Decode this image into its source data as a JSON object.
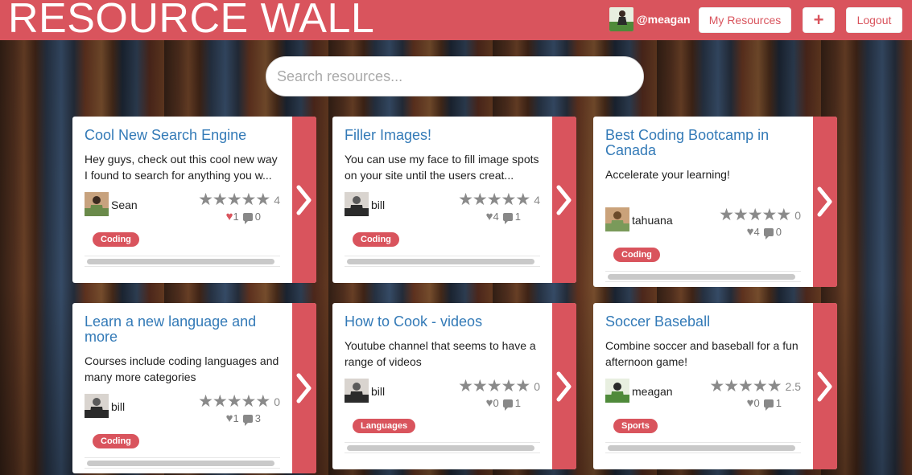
{
  "header": {
    "brand": "RESOURCE WALL",
    "username": "@meagan",
    "my_resources": "My Resources",
    "add_label": "+",
    "logout": "Logout"
  },
  "search": {
    "placeholder": "Search resources..."
  },
  "colors": {
    "accent": "#d9545d",
    "title": "#337ab7"
  },
  "cards": [
    {
      "title": "Cool New Search Engine",
      "description": "Hey guys, check out this cool new way I found to search for anything you w...",
      "author": "Sean",
      "rating": "4",
      "likes": "1",
      "comments": "0",
      "liked": true,
      "tag": "Coding",
      "stars": 0
    },
    {
      "title": "Filler Images!",
      "description": "You can use my face to fill image spots on your site until the users creat...",
      "author": "bill",
      "rating": "4",
      "likes": "4",
      "comments": "1",
      "liked": false,
      "tag": "Coding",
      "stars": 0
    },
    {
      "title": "Best Coding Bootcamp in Canada",
      "description": "Accelerate your learning!",
      "author": "tahuana",
      "rating": "0",
      "likes": "4",
      "comments": "0",
      "liked": false,
      "tag": "Coding",
      "stars": 0
    },
    {
      "title": "Learn a new language and more",
      "description": "Courses include coding languages and many more categories",
      "author": "bill",
      "rating": "0",
      "likes": "1",
      "comments": "3",
      "liked": false,
      "tag": "Coding",
      "stars": 0
    },
    {
      "title": "How to Cook - videos",
      "description": "Youtube channel that seems to have a range of videos",
      "author": "bill",
      "rating": "0",
      "likes": "0",
      "comments": "1",
      "liked": false,
      "tag": "Languages",
      "stars": 0
    },
    {
      "title": "Soccer Baseball",
      "description": "Combine soccer and baseball for a fun afternoon game!",
      "author": "meagan",
      "rating": "2.5",
      "likes": "0",
      "comments": "1",
      "liked": false,
      "tag": "Sports",
      "stars": 0
    }
  ]
}
